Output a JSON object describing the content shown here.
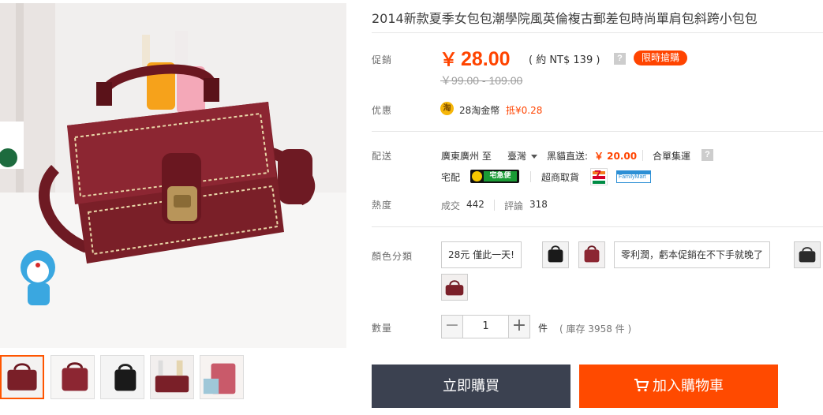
{
  "product": {
    "title": "2014新款夏季女包包潮學院風英倫複古郵差包時尚單肩包斜跨小包包"
  },
  "price": {
    "label": "促銷",
    "currency": "￥",
    "amount": "28.00",
    "approx": "( 約 NT$ 139 )",
    "help": "?",
    "badge": "限時搶購",
    "original": "￥99.00 - 109.00"
  },
  "promo": {
    "label": "优惠",
    "coin_icon_text": "淘",
    "coins": "28淘金幣",
    "discount": "抵¥0.28"
  },
  "delivery": {
    "label": "配送",
    "from": "廣東廣州 至",
    "to": "臺灣",
    "shipping_label": "黑貓直送:",
    "shipping_price": "￥ 20.00",
    "combined": "合單集運",
    "help": "?",
    "home_delivery": "宅配",
    "tk_logo_text": "宅急便",
    "store_pickup": "超商取貨",
    "seven_logo_text": "7",
    "familymart_logo_text": "FamilyMart"
  },
  "popularity": {
    "label": "熱度",
    "sold_label": "成交",
    "sold": "442",
    "reviews_label": "評論",
    "reviews": "318"
  },
  "color": {
    "label": "顏色分類",
    "options": [
      "28元 僅此一天!",
      "零利潤，虧本促銷在不下手就晚了"
    ]
  },
  "quantity": {
    "label": "數量",
    "minus": "−",
    "value": "1",
    "plus": "+",
    "unit": "件",
    "stock": "( 庫存 3958 件 )"
  },
  "actions": {
    "buy_now": "立即購買",
    "add_to_cart": "加入購物車"
  },
  "colors": {
    "accent": "#ff4400",
    "buy_button": "#3b4150",
    "cart_button": "#ff4a00",
    "bag": "#7a1f28"
  }
}
